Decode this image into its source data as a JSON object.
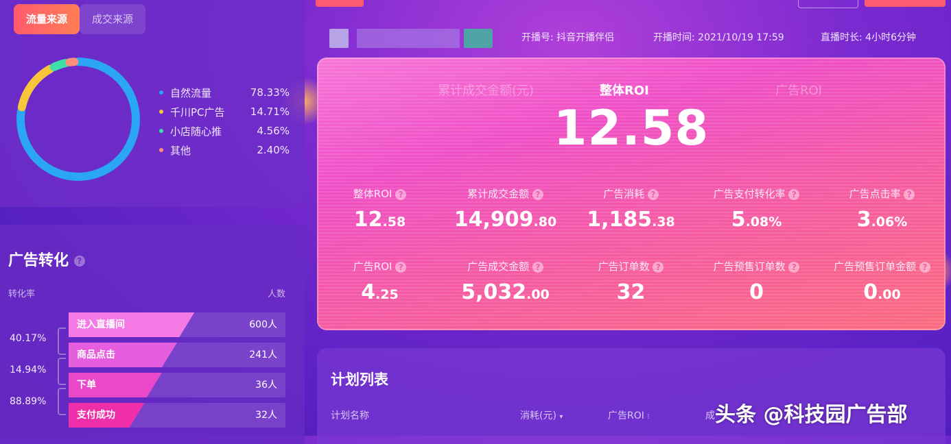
{
  "tabs": {
    "active": "流量来源",
    "inactive": "成交来源"
  },
  "traffic_sources": [
    {
      "name": "自然流量",
      "value": "78.33%",
      "pct": 78.33,
      "color": "#2ba6f5"
    },
    {
      "name": "千川PC广告",
      "value": "14.71%",
      "pct": 14.71,
      "color": "#f8c63a"
    },
    {
      "name": "小店随心推",
      "value": "4.56%",
      "pct": 4.56,
      "color": "#3ee0a8"
    },
    {
      "name": "其他",
      "value": "2.40%",
      "pct": 2.4,
      "color": "#ff8f7a"
    }
  ],
  "meta": {
    "channel_label": "开播号:",
    "channel_value": "抖音开播伴侣",
    "start_label": "开播时间:",
    "start_value": "2021/10/19 17:59",
    "duration_label": "直播时长:",
    "duration_value": "4小时6分钟"
  },
  "hero": {
    "left_tab": "累计成交金额(元)",
    "center_tab": "整体ROI",
    "right_tab": "广告ROI",
    "value": "12.58"
  },
  "metrics_row1": [
    {
      "label": "整体ROI",
      "int": "12",
      "dec": ".58"
    },
    {
      "label": "累计成交金额",
      "int": "14,909",
      "dec": ".80"
    },
    {
      "label": "广告消耗",
      "int": "1,185",
      "dec": ".38"
    },
    {
      "label": "广告支付转化率",
      "int": "5",
      "dec": ".08%"
    },
    {
      "label": "广告点击率",
      "int": "3",
      "dec": ".06%"
    }
  ],
  "metrics_row2": [
    {
      "label": "广告ROI",
      "int": "4",
      "dec": ".25"
    },
    {
      "label": "广告成交金额",
      "int": "5,032",
      "dec": ".00"
    },
    {
      "label": "广告订单数",
      "int": "32",
      "dec": ""
    },
    {
      "label": "广告预售订单数",
      "int": "0",
      "dec": ""
    },
    {
      "label": "广告预售订单金额",
      "int": "0",
      "dec": ".00"
    }
  ],
  "ad_conversion": {
    "title": "广告转化",
    "col_left": "转化率",
    "col_right": "人数",
    "steps": [
      {
        "label": "进入直播间",
        "count": "600人",
        "fill": 0.58,
        "color": "#f57ae6"
      },
      {
        "label": "商品点击",
        "count": "241人",
        "fill": 0.5,
        "color": "#e75de0"
      },
      {
        "label": "下单",
        "count": "36人",
        "fill": 0.43,
        "color": "#ea47c9"
      },
      {
        "label": "支付成功",
        "count": "32人",
        "fill": 0.35,
        "color": "#ef2fa9"
      }
    ],
    "rates": [
      "40.17%",
      "14.94%",
      "88.89%"
    ]
  },
  "plan_list": {
    "title": "计划列表",
    "columns": [
      "计划名称",
      "消耗(元)",
      "广告ROI",
      "成"
    ]
  },
  "watermark": "头条 @科技园广告部"
}
